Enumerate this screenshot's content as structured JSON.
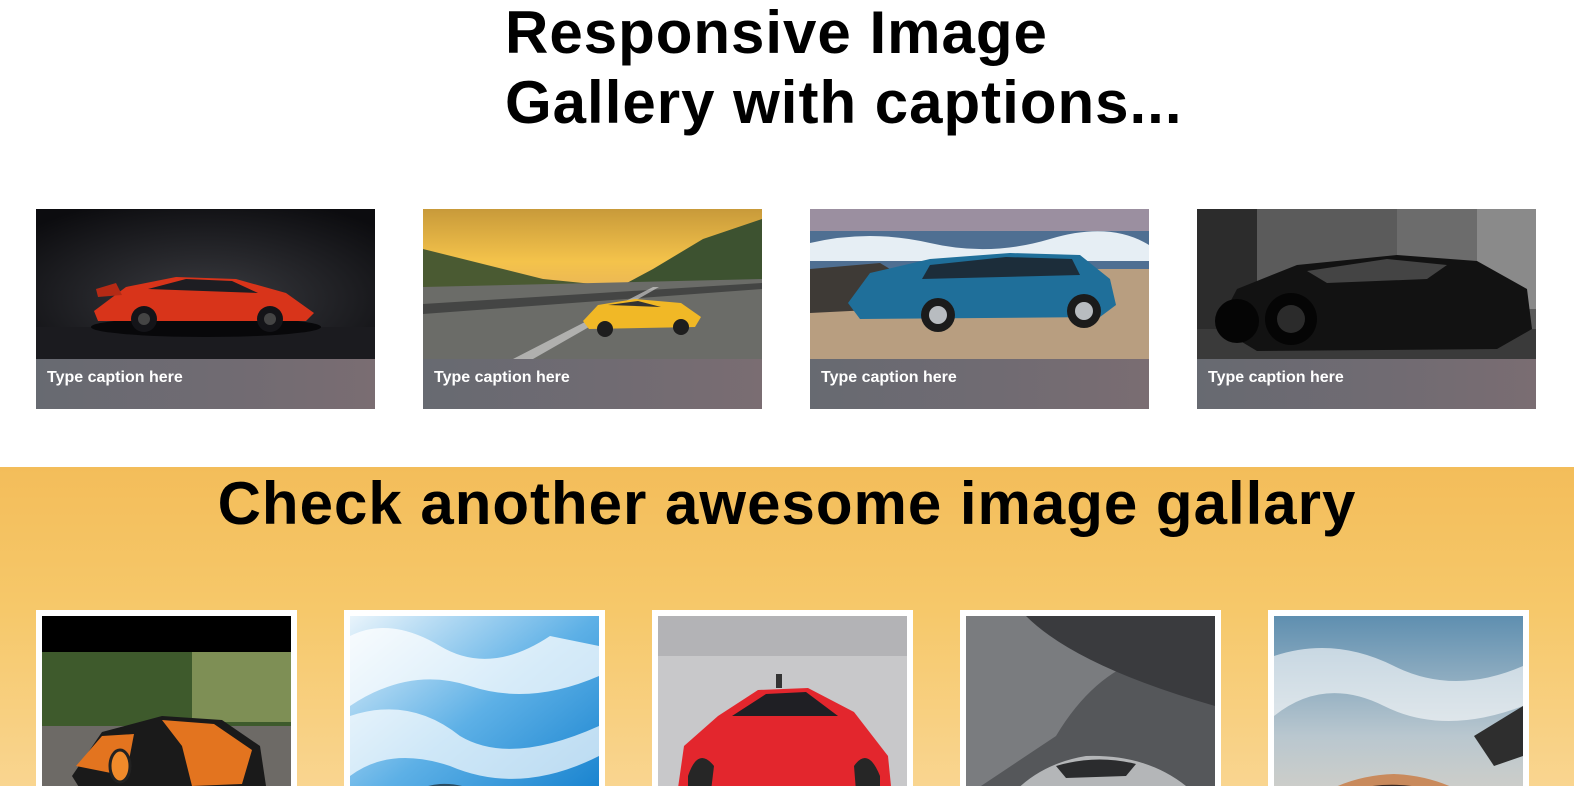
{
  "page": {
    "title_line1": "Responsive Image",
    "title_line2": "Gallery with captions..."
  },
  "gallery1": {
    "items": [
      {
        "caption": "Type caption here",
        "image": "orange-sports-car-dark"
      },
      {
        "caption": "Type caption here",
        "image": "yellow-sports-car-road-sunset"
      },
      {
        "caption": "Type caption here",
        "image": "blue-suv-beach"
      },
      {
        "caption": "Type caption here",
        "image": "black-sports-car-street"
      }
    ]
  },
  "gallery2": {
    "title": "Check another awesome image gallary",
    "background": "#f5c463",
    "items": [
      {
        "image": "orange-black-hypercar-forest"
      },
      {
        "image": "blue-sky-clouds-car"
      },
      {
        "image": "red-sports-car-front"
      },
      {
        "image": "silver-car-dark-hill"
      },
      {
        "image": "copper-car-cloudy-sky"
      }
    ]
  }
}
